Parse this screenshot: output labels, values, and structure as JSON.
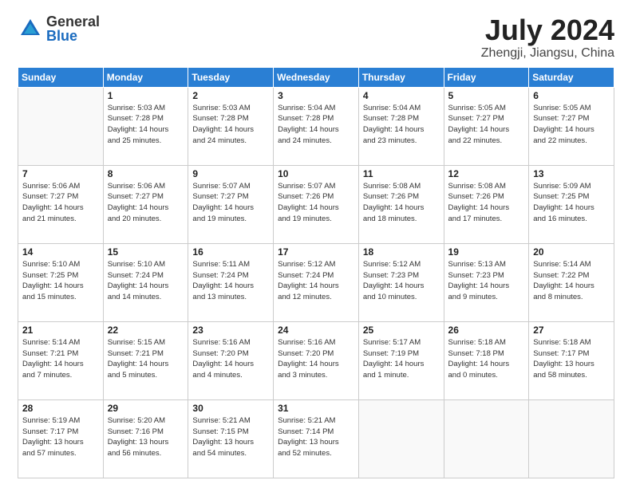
{
  "header": {
    "logo_general": "General",
    "logo_blue": "Blue",
    "month_title": "July 2024",
    "location": "Zhengji, Jiangsu, China"
  },
  "weekdays": [
    "Sunday",
    "Monday",
    "Tuesday",
    "Wednesday",
    "Thursday",
    "Friday",
    "Saturday"
  ],
  "weeks": [
    [
      {
        "day": "",
        "sunrise": "",
        "sunset": "",
        "daylight": ""
      },
      {
        "day": "1",
        "sunrise": "Sunrise: 5:03 AM",
        "sunset": "Sunset: 7:28 PM",
        "daylight": "Daylight: 14 hours and 25 minutes."
      },
      {
        "day": "2",
        "sunrise": "Sunrise: 5:03 AM",
        "sunset": "Sunset: 7:28 PM",
        "daylight": "Daylight: 14 hours and 24 minutes."
      },
      {
        "day": "3",
        "sunrise": "Sunrise: 5:04 AM",
        "sunset": "Sunset: 7:28 PM",
        "daylight": "Daylight: 14 hours and 24 minutes."
      },
      {
        "day": "4",
        "sunrise": "Sunrise: 5:04 AM",
        "sunset": "Sunset: 7:28 PM",
        "daylight": "Daylight: 14 hours and 23 minutes."
      },
      {
        "day": "5",
        "sunrise": "Sunrise: 5:05 AM",
        "sunset": "Sunset: 7:27 PM",
        "daylight": "Daylight: 14 hours and 22 minutes."
      },
      {
        "day": "6",
        "sunrise": "Sunrise: 5:05 AM",
        "sunset": "Sunset: 7:27 PM",
        "daylight": "Daylight: 14 hours and 22 minutes."
      }
    ],
    [
      {
        "day": "7",
        "sunrise": "Sunrise: 5:06 AM",
        "sunset": "Sunset: 7:27 PM",
        "daylight": "Daylight: 14 hours and 21 minutes."
      },
      {
        "day": "8",
        "sunrise": "Sunrise: 5:06 AM",
        "sunset": "Sunset: 7:27 PM",
        "daylight": "Daylight: 14 hours and 20 minutes."
      },
      {
        "day": "9",
        "sunrise": "Sunrise: 5:07 AM",
        "sunset": "Sunset: 7:27 PM",
        "daylight": "Daylight: 14 hours and 19 minutes."
      },
      {
        "day": "10",
        "sunrise": "Sunrise: 5:07 AM",
        "sunset": "Sunset: 7:26 PM",
        "daylight": "Daylight: 14 hours and 19 minutes."
      },
      {
        "day": "11",
        "sunrise": "Sunrise: 5:08 AM",
        "sunset": "Sunset: 7:26 PM",
        "daylight": "Daylight: 14 hours and 18 minutes."
      },
      {
        "day": "12",
        "sunrise": "Sunrise: 5:08 AM",
        "sunset": "Sunset: 7:26 PM",
        "daylight": "Daylight: 14 hours and 17 minutes."
      },
      {
        "day": "13",
        "sunrise": "Sunrise: 5:09 AM",
        "sunset": "Sunset: 7:25 PM",
        "daylight": "Daylight: 14 hours and 16 minutes."
      }
    ],
    [
      {
        "day": "14",
        "sunrise": "Sunrise: 5:10 AM",
        "sunset": "Sunset: 7:25 PM",
        "daylight": "Daylight: 14 hours and 15 minutes."
      },
      {
        "day": "15",
        "sunrise": "Sunrise: 5:10 AM",
        "sunset": "Sunset: 7:24 PM",
        "daylight": "Daylight: 14 hours and 14 minutes."
      },
      {
        "day": "16",
        "sunrise": "Sunrise: 5:11 AM",
        "sunset": "Sunset: 7:24 PM",
        "daylight": "Daylight: 14 hours and 13 minutes."
      },
      {
        "day": "17",
        "sunrise": "Sunrise: 5:12 AM",
        "sunset": "Sunset: 7:24 PM",
        "daylight": "Daylight: 14 hours and 12 minutes."
      },
      {
        "day": "18",
        "sunrise": "Sunrise: 5:12 AM",
        "sunset": "Sunset: 7:23 PM",
        "daylight": "Daylight: 14 hours and 10 minutes."
      },
      {
        "day": "19",
        "sunrise": "Sunrise: 5:13 AM",
        "sunset": "Sunset: 7:23 PM",
        "daylight": "Daylight: 14 hours and 9 minutes."
      },
      {
        "day": "20",
        "sunrise": "Sunrise: 5:14 AM",
        "sunset": "Sunset: 7:22 PM",
        "daylight": "Daylight: 14 hours and 8 minutes."
      }
    ],
    [
      {
        "day": "21",
        "sunrise": "Sunrise: 5:14 AM",
        "sunset": "Sunset: 7:21 PM",
        "daylight": "Daylight: 14 hours and 7 minutes."
      },
      {
        "day": "22",
        "sunrise": "Sunrise: 5:15 AM",
        "sunset": "Sunset: 7:21 PM",
        "daylight": "Daylight: 14 hours and 5 minutes."
      },
      {
        "day": "23",
        "sunrise": "Sunrise: 5:16 AM",
        "sunset": "Sunset: 7:20 PM",
        "daylight": "Daylight: 14 hours and 4 minutes."
      },
      {
        "day": "24",
        "sunrise": "Sunrise: 5:16 AM",
        "sunset": "Sunset: 7:20 PM",
        "daylight": "Daylight: 14 hours and 3 minutes."
      },
      {
        "day": "25",
        "sunrise": "Sunrise: 5:17 AM",
        "sunset": "Sunset: 7:19 PM",
        "daylight": "Daylight: 14 hours and 1 minute."
      },
      {
        "day": "26",
        "sunrise": "Sunrise: 5:18 AM",
        "sunset": "Sunset: 7:18 PM",
        "daylight": "Daylight: 14 hours and 0 minutes."
      },
      {
        "day": "27",
        "sunrise": "Sunrise: 5:18 AM",
        "sunset": "Sunset: 7:17 PM",
        "daylight": "Daylight: 13 hours and 58 minutes."
      }
    ],
    [
      {
        "day": "28",
        "sunrise": "Sunrise: 5:19 AM",
        "sunset": "Sunset: 7:17 PM",
        "daylight": "Daylight: 13 hours and 57 minutes."
      },
      {
        "day": "29",
        "sunrise": "Sunrise: 5:20 AM",
        "sunset": "Sunset: 7:16 PM",
        "daylight": "Daylight: 13 hours and 56 minutes."
      },
      {
        "day": "30",
        "sunrise": "Sunrise: 5:21 AM",
        "sunset": "Sunset: 7:15 PM",
        "daylight": "Daylight: 13 hours and 54 minutes."
      },
      {
        "day": "31",
        "sunrise": "Sunrise: 5:21 AM",
        "sunset": "Sunset: 7:14 PM",
        "daylight": "Daylight: 13 hours and 52 minutes."
      },
      {
        "day": "",
        "sunrise": "",
        "sunset": "",
        "daylight": ""
      },
      {
        "day": "",
        "sunrise": "",
        "sunset": "",
        "daylight": ""
      },
      {
        "day": "",
        "sunrise": "",
        "sunset": "",
        "daylight": ""
      }
    ]
  ]
}
